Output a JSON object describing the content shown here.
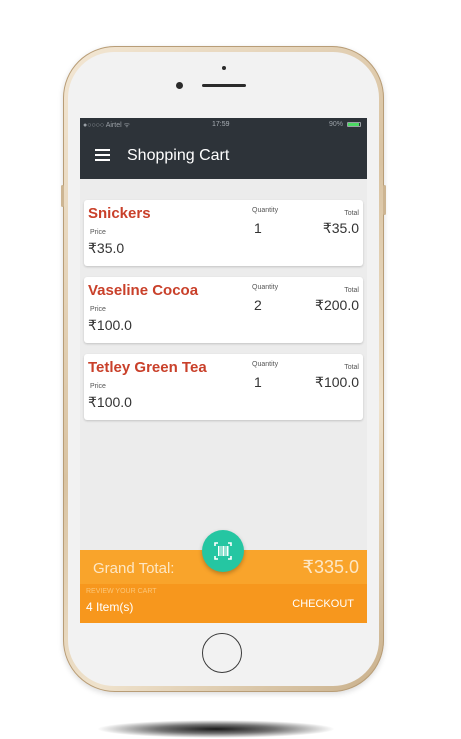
{
  "colors": {
    "app_bar": "#2d3339",
    "item_name": "#c9402a",
    "footer_top": "#f9a42b",
    "footer_bottom": "#f7971d",
    "fab": "#25c6a2",
    "phone_gold": "#d9c3a2"
  },
  "status_bar": {
    "carrier": "●○○○○ Airtel ᯤ",
    "time": "17:59",
    "battery_pct": "90%",
    "battery_level": 0.9
  },
  "app_bar": {
    "menu_icon": "hamburger-menu-icon",
    "title": "Shopping Cart"
  },
  "cart": {
    "price_label": "Price",
    "quantity_label": "Quantity",
    "total_label": "Total",
    "items": [
      {
        "name": "Snickers",
        "price": "₹35.0",
        "quantity": "1",
        "total": "₹35.0"
      },
      {
        "name": "Vaseline Cocoa",
        "price": "₹100.0",
        "quantity": "2",
        "total": "₹200.0"
      },
      {
        "name": "Tetley Green Tea",
        "price": "₹100.0",
        "quantity": "1",
        "total": "₹100.0"
      }
    ]
  },
  "footer": {
    "grand_total_label": "Grand Total:",
    "grand_total_value": "₹335.0",
    "review_label": "REVIEW YOUR CART",
    "items_count": "4 Item(s)",
    "checkout_label": "CHECKOUT"
  },
  "fab": {
    "icon": "barcode-scan-icon"
  }
}
